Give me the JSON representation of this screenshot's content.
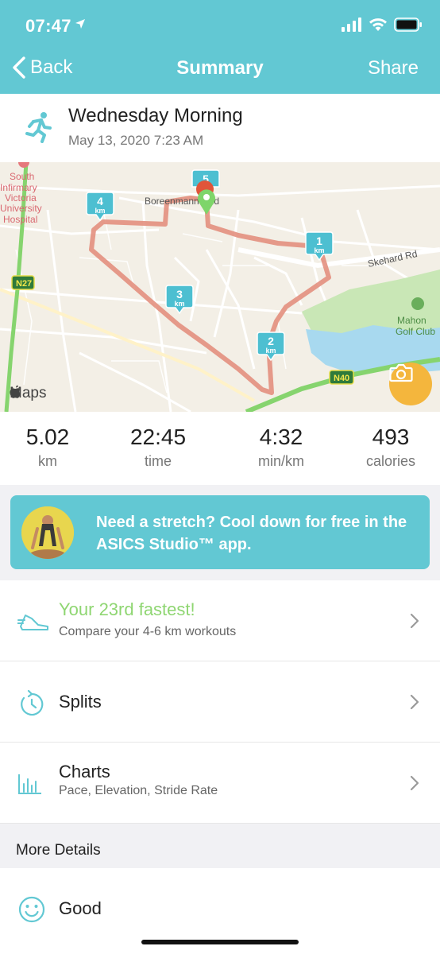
{
  "status_bar": {
    "time": "07:47"
  },
  "nav": {
    "back_label": "Back",
    "title": "Summary",
    "share_label": "Share"
  },
  "workout": {
    "title": "Wednesday Morning",
    "date": "May 13, 2020 7:23 AM"
  },
  "map": {
    "attribution": "Maps",
    "labels": {
      "hospital_line1": "South",
      "hospital_line2": "Infirmary",
      "hospital_line3": "Victoria",
      "hospital_line4": "University",
      "hospital_line5": "Hospital",
      "road1": "Boreenmanna Rd",
      "road2": "Skehard Rd",
      "golf1": "Mahon",
      "golf2": "Golf Club",
      "n27": "N27",
      "n40": "N40"
    },
    "km_markers": [
      {
        "num": "1",
        "unit": "km"
      },
      {
        "num": "2",
        "unit": "km"
      },
      {
        "num": "3",
        "unit": "km"
      },
      {
        "num": "4",
        "unit": "km"
      },
      {
        "num": "5",
        "unit": ""
      }
    ]
  },
  "stats": [
    {
      "value": "5.02",
      "unit": "km"
    },
    {
      "value": "22:45",
      "unit": "time"
    },
    {
      "value": "4:32",
      "unit": "min/km"
    },
    {
      "value": "493",
      "unit": "calories"
    }
  ],
  "promo": {
    "text": "Need a stretch? Cool down for free in the ASICS Studio™ app."
  },
  "rows": {
    "fastest": {
      "title": "Your 23rd fastest!",
      "subtitle": "Compare your 4-6 km workouts"
    },
    "splits": {
      "title": "Splits"
    },
    "charts": {
      "title": "Charts",
      "subtitle": "Pace, Elevation, Stride Rate"
    }
  },
  "more_details": {
    "header": "More Details",
    "feeling": "Good"
  },
  "colors": {
    "accent": "#62c8d3",
    "route": "#e28a78",
    "green_text": "#8fd672",
    "camera": "#f4b63d"
  }
}
